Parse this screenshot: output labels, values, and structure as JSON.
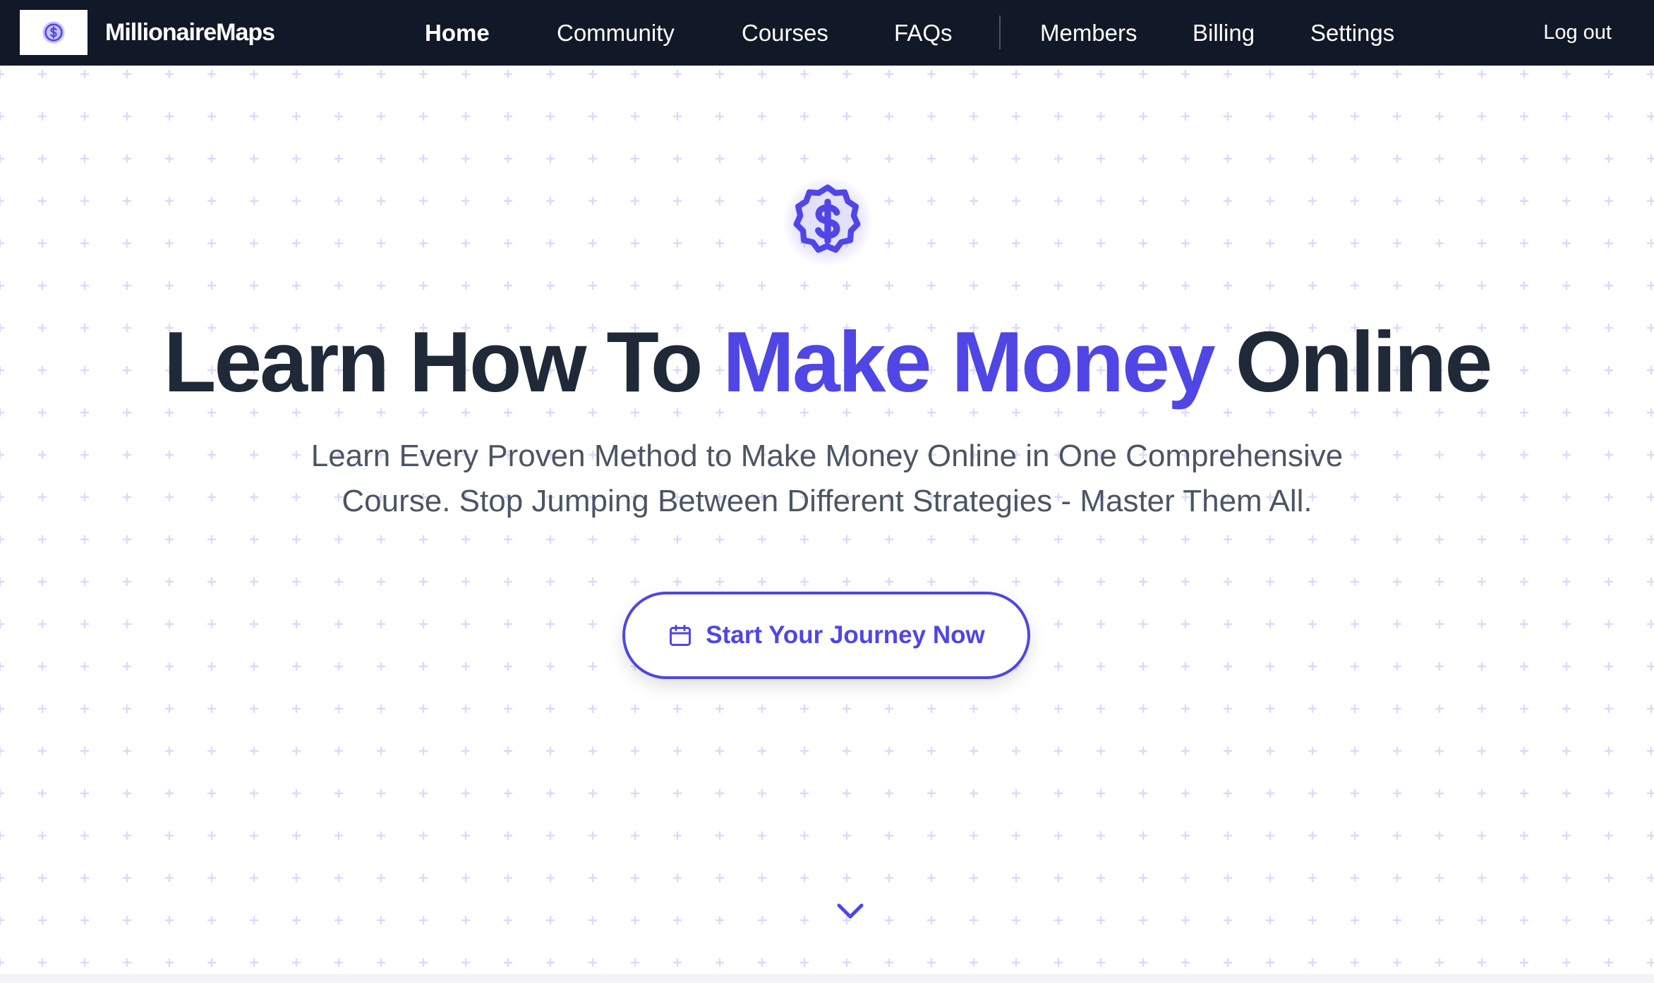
{
  "brand": {
    "name": "MillionaireMaps",
    "logo_icon": "dollar-badge-icon"
  },
  "nav": {
    "items": [
      {
        "label": "Home",
        "active": true
      },
      {
        "label": "Community"
      },
      {
        "label": "Courses"
      },
      {
        "label": "FAQs"
      },
      {
        "label": "Members"
      },
      {
        "label": "Billing"
      },
      {
        "label": "Settings"
      }
    ],
    "logout_label": "Log out"
  },
  "hero": {
    "icon": "dollar-badge-icon",
    "headline_part1": "Learn How To ",
    "headline_accent": "Make Money",
    "headline_part2": " Online",
    "subtitle": "Learn Every Proven Method to Make Money Online in One Comprehensive Course. Stop Jumping Between Different Strategies - Master Them All.",
    "cta_label": "Start Your Journey Now",
    "cta_icon": "calendar-icon",
    "scroll_icon": "chevron-down-icon"
  },
  "colors": {
    "navbar_bg": "#111827",
    "accent": "#4f46e5",
    "headline": "#1f2937",
    "subtitle": "#4b5563",
    "pattern": "#ddd9fb"
  }
}
